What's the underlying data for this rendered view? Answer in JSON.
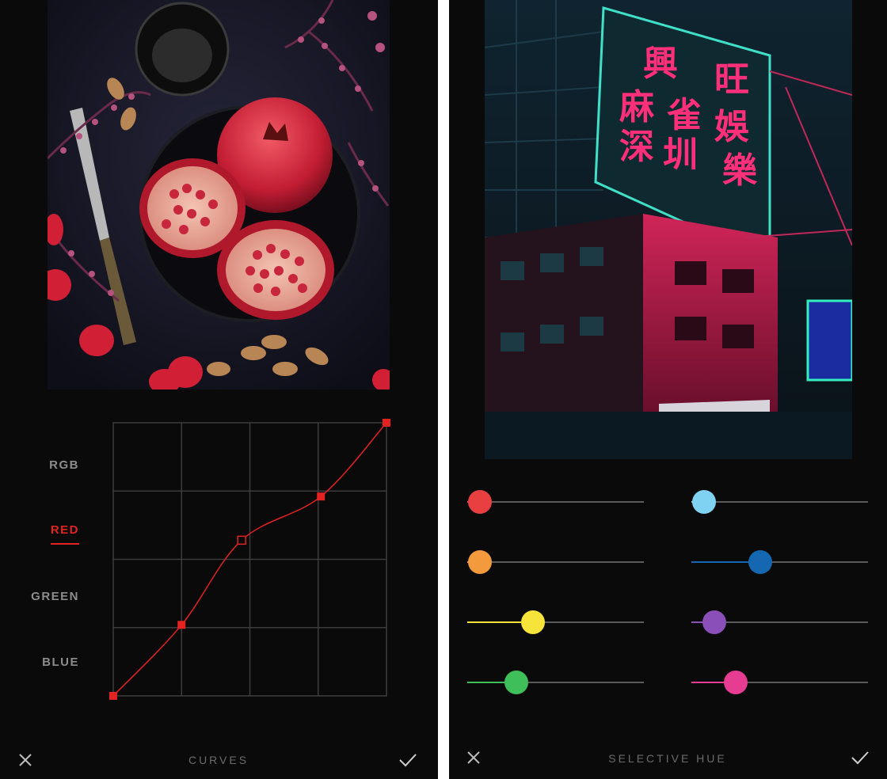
{
  "curves_screen": {
    "channels": [
      {
        "label": "RGB",
        "active": false
      },
      {
        "label": "RED",
        "active": true
      },
      {
        "label": "GREEN",
        "active": false
      },
      {
        "label": "BLUE",
        "active": false
      }
    ],
    "title": "CURVES",
    "accent_color": "#e32222",
    "curve_points": [
      {
        "input": 0,
        "output": 0
      },
      {
        "input": 0.25,
        "output": 0.26
      },
      {
        "input": 0.47,
        "output": 0.57
      },
      {
        "input": 0.76,
        "output": 0.73
      },
      {
        "input": 1,
        "output": 1
      }
    ],
    "selected_point_index": 2
  },
  "selective_hue_screen": {
    "title": "SELECTIVE HUE",
    "sliders": [
      {
        "name": "red",
        "color": "#e84040",
        "value": 0.07
      },
      {
        "name": "orange",
        "color": "#f29a3c",
        "value": 0.07
      },
      {
        "name": "yellow",
        "color": "#f6e43a",
        "value": 0.37
      },
      {
        "name": "green",
        "color": "#3fbf5a",
        "value": 0.28
      },
      {
        "name": "aqua",
        "color": "#7fd2f2",
        "value": 0.07
      },
      {
        "name": "blue",
        "color": "#1467b0",
        "value": 0.39
      },
      {
        "name": "purple",
        "color": "#8a4fb8",
        "value": 0.13
      },
      {
        "name": "magenta",
        "color": "#e63c92",
        "value": 0.25
      }
    ]
  },
  "icons": {
    "cancel": "close-icon",
    "confirm": "checkmark-icon"
  }
}
